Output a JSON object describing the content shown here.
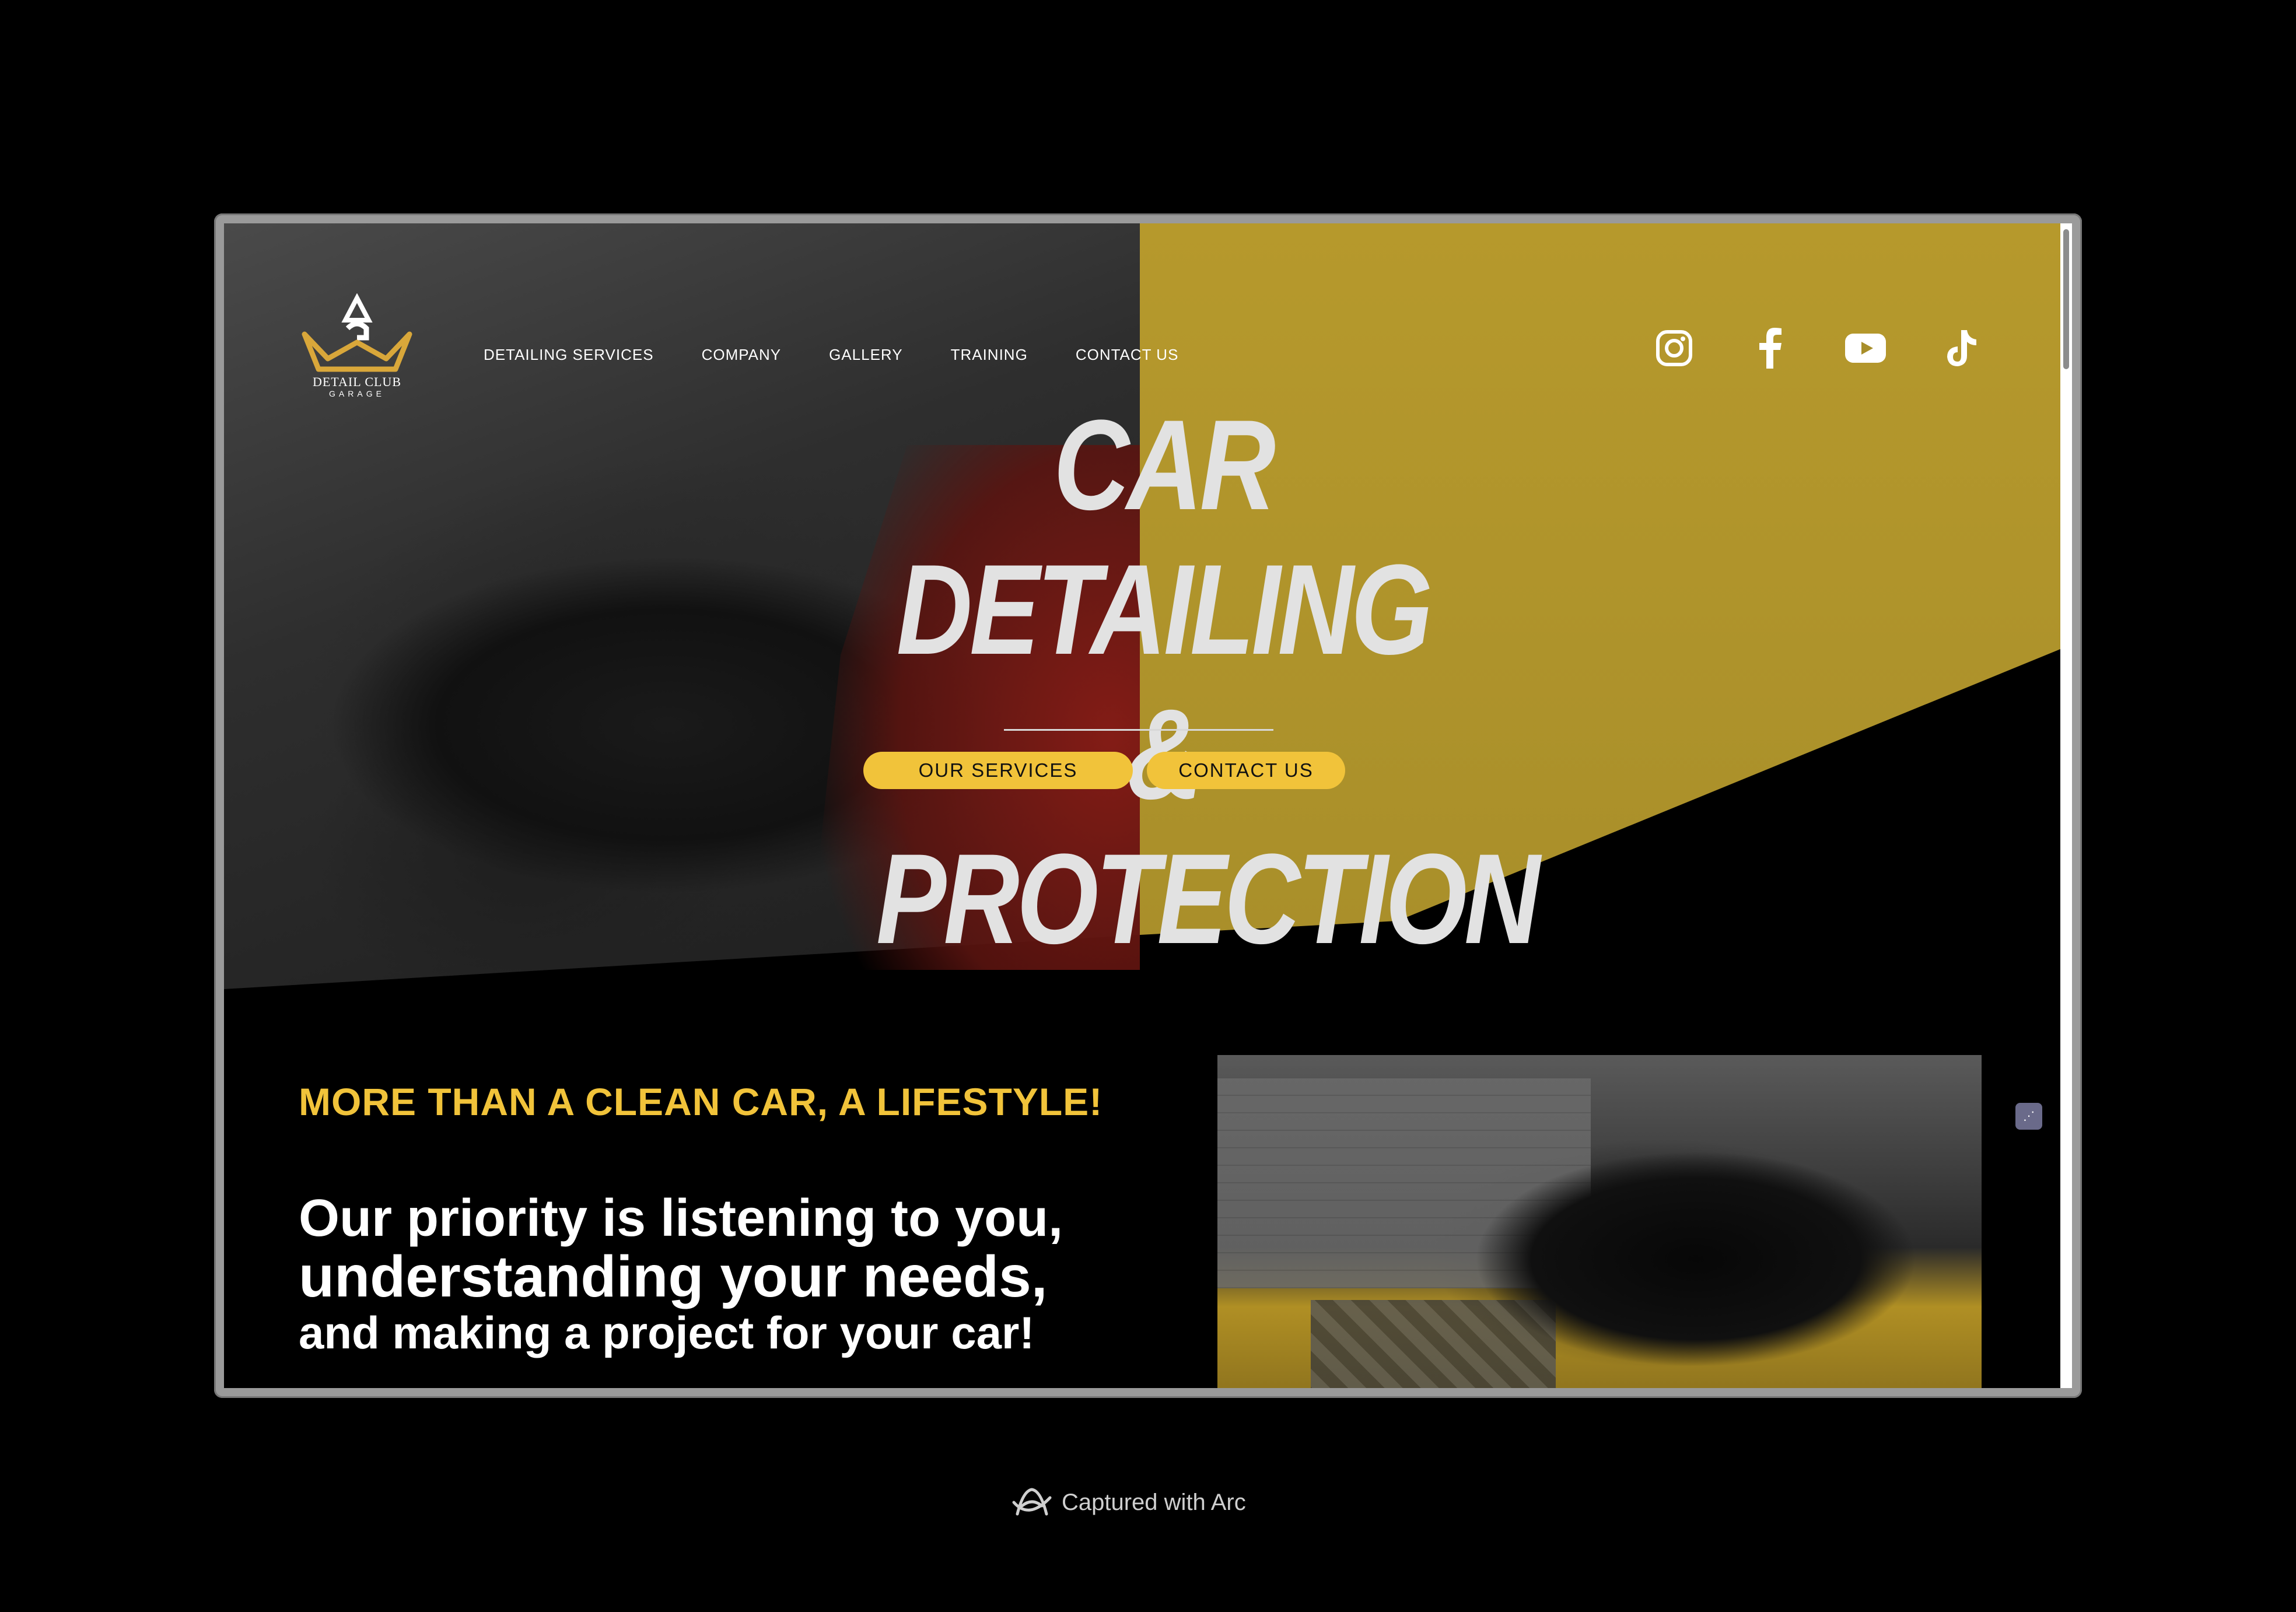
{
  "brand": {
    "logo_title": "DETAIL CLUB",
    "logo_subtitle": "GARAGE",
    "accent_color": "#f1c33a"
  },
  "nav": {
    "items": [
      {
        "label": "DETAILING SERVICES"
      },
      {
        "label": "COMPANY"
      },
      {
        "label": "GALLERY"
      },
      {
        "label": "TRAINING"
      },
      {
        "label": "CONTACT US"
      }
    ]
  },
  "social": {
    "icons": [
      "instagram-icon",
      "facebook-icon",
      "youtube-icon",
      "tiktok-icon"
    ]
  },
  "hero": {
    "title_line1": "CAR DETAILING",
    "title_line2": "& PROTECTION",
    "primary_button": "OUR SERVICES",
    "secondary_button": "CONTACT US"
  },
  "intro": {
    "kicker": "MORE THAN A CLEAN CAR, A LIFESTYLE!",
    "line1": "Our priority is listening to you,",
    "line2": "understanding your needs,",
    "line3": "and making a project for your car!"
  },
  "footer_badge": {
    "text": "Captured with Arc"
  }
}
